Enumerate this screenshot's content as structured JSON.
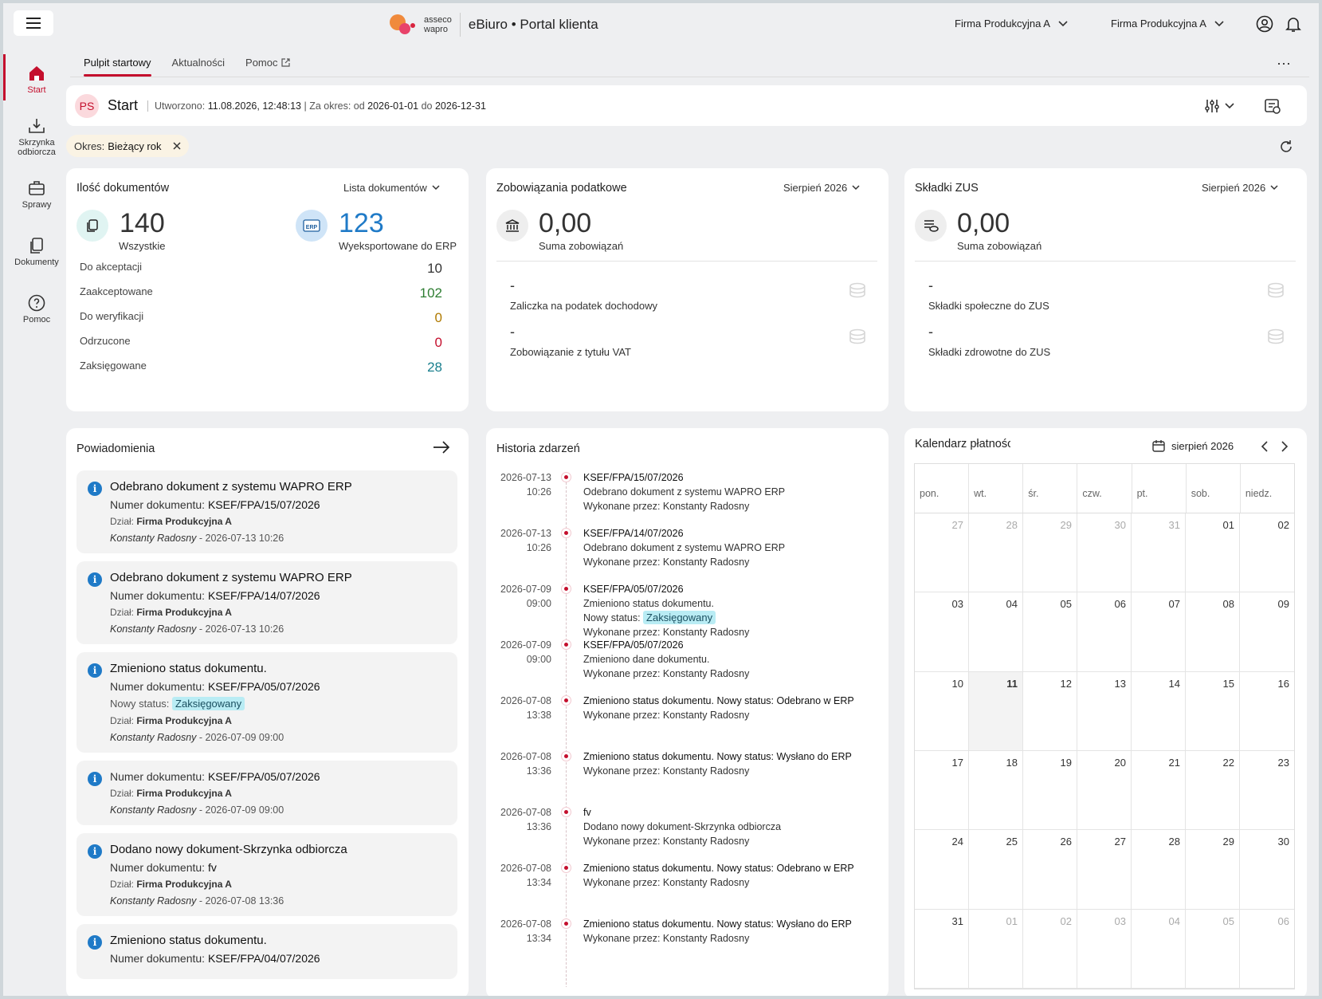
{
  "topbar": {
    "brand_top": "asseco",
    "brand_bottom": "wapro",
    "app_title": "eBiuro • Portal klienta",
    "company_1": "Firma Produkcyjna A",
    "company_2": "Firma Produkcyjna A"
  },
  "sidebar": {
    "items": [
      {
        "label": "Start"
      },
      {
        "label": "Skrzynka odbiorcza"
      },
      {
        "label": "Sprawy"
      },
      {
        "label": "Dokumenty"
      },
      {
        "label": "Pomoc"
      }
    ]
  },
  "tabs": [
    {
      "label": "Pulpit startowy"
    },
    {
      "label": "Aktualności"
    },
    {
      "label": "Pomoc"
    }
  ],
  "header": {
    "avatar": "PS",
    "title": "Start",
    "created_label": "Utworzono:",
    "created_value": "11.08.2026, 12:48:13",
    "period_label": "| Za okres: od",
    "from": "2026-01-01",
    "to_label": "do",
    "to": "2026-12-31"
  },
  "filter": {
    "label": "Okres:",
    "value": "Bieżący rok"
  },
  "docs": {
    "title": "Ilość dokumentów",
    "link": "Lista dokumentów",
    "all_value": "140",
    "all_label": "Wszystkie",
    "erp_value": "123",
    "erp_label": "Wyeksportowane do ERP",
    "erp_badge": "ERP",
    "rows": [
      {
        "label": "Do akceptacji",
        "value": "10",
        "color": "#333333"
      },
      {
        "label": "Zaakceptowane",
        "value": "102",
        "color": "#2e7d32"
      },
      {
        "label": "Do weryfikacji",
        "value": "0",
        "color": "#b07a00"
      },
      {
        "label": "Odrzucone",
        "value": "0",
        "color": "#c40f2d"
      },
      {
        "label": "Zaksięgowane",
        "value": "28",
        "color": "#1a7f8e"
      }
    ]
  },
  "tax": {
    "title": "Zobowiązania podatkowe",
    "period": "Sierpień 2026",
    "sum": "0,00",
    "sum_label": "Suma zobowiązań",
    "items": [
      {
        "value": "-",
        "label": "Zaliczka na podatek dochodowy"
      },
      {
        "value": "-",
        "label": "Zobowiązanie z tytułu VAT"
      }
    ]
  },
  "zus": {
    "title": "Składki ZUS",
    "period": "Sierpień 2026",
    "sum": "0,00",
    "sum_label": "Suma zobowiązań",
    "items": [
      {
        "value": "-",
        "label": "Składki społeczne do ZUS"
      },
      {
        "value": "-",
        "label": "Składki zdrowotne do ZUS"
      }
    ]
  },
  "notifications": {
    "title": "Powiadomienia",
    "items": [
      {
        "title": "Odebrano dokument z systemu WAPRO ERP",
        "num_label": "Numer dokumentu:",
        "num": "KSEF/FPA/15/07/2026",
        "dept_label": "Dział:",
        "dept": "Firma Produkcyjna A",
        "author": "Konstanty Radosny",
        "date": " - 2026-07-13 10:26"
      },
      {
        "title": "Odebrano dokument z systemu WAPRO ERP",
        "num_label": "Numer dokumentu:",
        "num": "KSEF/FPA/14/07/2026",
        "dept_label": "Dział:",
        "dept": "Firma Produkcyjna A",
        "author": "Konstanty Radosny",
        "date": " - 2026-07-13 10:26"
      },
      {
        "title": "Zmieniono status dokumentu.",
        "num_label": "Numer dokumentu:",
        "num": "KSEF/FPA/05/07/2026",
        "status_label": "Nowy status:",
        "status": "Zaksięgowany",
        "dept_label": "Dział:",
        "dept": "Firma Produkcyjna A",
        "author": "Konstanty Radosny",
        "date": " - 2026-07-09 09:00"
      },
      {
        "num_label": "Numer dokumentu:",
        "num": "KSEF/FPA/05/07/2026",
        "dept_label": "Dział:",
        "dept": "Firma Produkcyjna A",
        "author": "Konstanty Radosny",
        "date": " - 2026-07-09 09:00"
      },
      {
        "title": "Dodano nowy dokument-Skrzynka odbiorcza",
        "num_label": "Numer dokumentu:",
        "num": "fv",
        "dept_label": "Dział:",
        "dept": "Firma Produkcyjna A",
        "author": "Konstanty Radosny",
        "date": " - 2026-07-08 13:36"
      },
      {
        "title": "Zmieniono status dokumentu.",
        "num_label": "Numer dokumentu:",
        "num": "KSEF/FPA/04/07/2026"
      }
    ]
  },
  "history": {
    "title": "Historia zdarzeń",
    "events": [
      {
        "date": "2026-07-13",
        "time": "10:26",
        "lines": [
          "KSEF/FPA/15/07/2026",
          "Odebrano dokument z systemu WAPRO ERP",
          "Wykonane przez: Konstanty Radosny"
        ]
      },
      {
        "date": "2026-07-13",
        "time": "10:26",
        "lines": [
          "KSEF/FPA/14/07/2026",
          "Odebrano dokument z systemu WAPRO ERP",
          "Wykonane przez: Konstanty Radosny"
        ]
      },
      {
        "date": "2026-07-09",
        "time": "09:00",
        "lines": [
          "KSEF/FPA/05/07/2026",
          "Zmieniono status dokumentu."
        ],
        "status_label": "Nowy status:",
        "status": "Zaksięgowany",
        "after": "Wykonane przez: Konstanty Radosny"
      },
      {
        "date": "2026-07-09",
        "time": "09:00",
        "lines": [
          "KSEF/FPA/05/07/2026",
          "Zmieniono dane dokumentu.",
          "Wykonane przez: Konstanty Radosny"
        ]
      },
      {
        "date": "2026-07-08",
        "time": "13:38",
        "lines": [
          "Zmieniono status dokumentu. Nowy status: Odebrano w ERP",
          "Wykonane przez: Konstanty Radosny"
        ]
      },
      {
        "date": "2026-07-08",
        "time": "13:36",
        "lines": [
          "Zmieniono status dokumentu. Nowy status: Wysłano do ERP",
          "Wykonane przez: Konstanty Radosny"
        ]
      },
      {
        "date": "2026-07-08",
        "time": "13:36",
        "lines": [
          "fv",
          "Dodano nowy dokument-Skrzynka odbiorcza",
          "Wykonane przez: Konstanty Radosny"
        ]
      },
      {
        "date": "2026-07-08",
        "time": "13:34",
        "lines": [
          "Zmieniono status dokumentu. Nowy status: Odebrano w ERP",
          "Wykonane przez: Konstanty Radosny"
        ]
      },
      {
        "date": "2026-07-08",
        "time": "13:34",
        "lines": [
          "Zmieniono status dokumentu. Nowy status: Wysłano do ERP",
          "Wykonane przez: Konstanty Radosny"
        ]
      }
    ]
  },
  "calendar": {
    "title": "Kalendarz płatnośc",
    "month": "sierpień 2026",
    "weekdays": [
      "pon.",
      "wt.",
      "śr.",
      "czw.",
      "pt.",
      "sob.",
      "niedz."
    ],
    "days": [
      "27",
      "28",
      "29",
      "30",
      "31",
      "01",
      "02",
      "03",
      "04",
      "05",
      "06",
      "07",
      "08",
      "09",
      "10",
      "11",
      "12",
      "13",
      "14",
      "15",
      "16",
      "17",
      "18",
      "19",
      "20",
      "21",
      "22",
      "23",
      "24",
      "25",
      "26",
      "27",
      "28",
      "29",
      "30",
      "31",
      "01",
      "02",
      "03",
      "04",
      "05",
      "06"
    ],
    "today": "11"
  }
}
